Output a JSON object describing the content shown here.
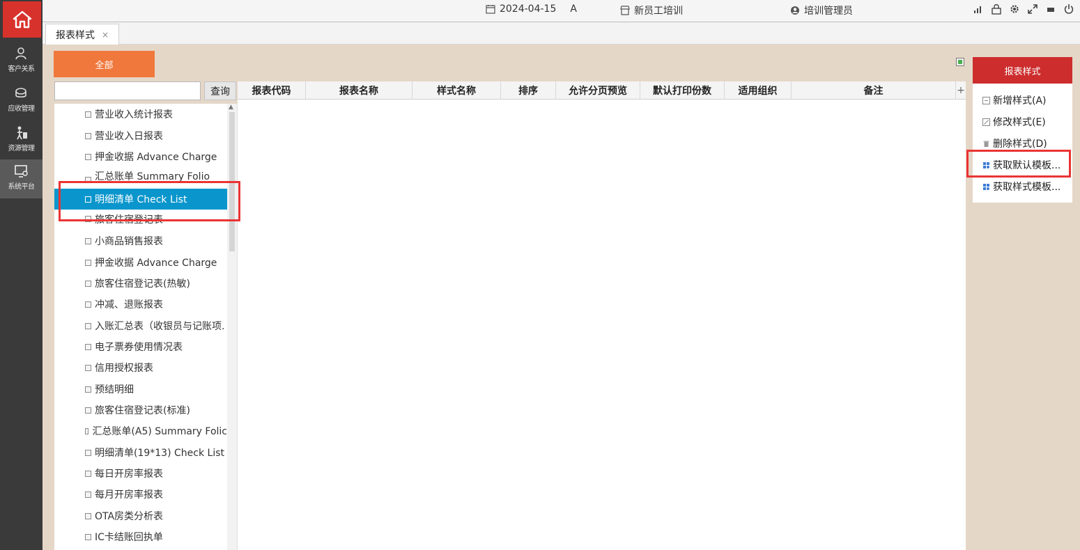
{
  "topbar": {
    "date": "2024-04-15",
    "shift": "A",
    "hotel": "新员工培训",
    "user": "培训管理员"
  },
  "nav": {
    "items": [
      {
        "label": "客户关系",
        "icon": "users-icon"
      },
      {
        "label": "应收管理",
        "icon": "coins-icon"
      },
      {
        "label": "资源管理",
        "icon": "resource-icon"
      },
      {
        "label": "系统平台",
        "icon": "system-settings-icon"
      }
    ]
  },
  "tabs": [
    {
      "label": "报表样式",
      "close": "×"
    }
  ],
  "left": {
    "all_button": "全部",
    "search_placeholder": "",
    "query_button": "查询",
    "tree_items": [
      "营业收入统计报表",
      "营业收入日报表",
      "押金收据 Advance Charge",
      "汇总账单 Summary Folio",
      "明细清单 Check List",
      "旅客住宿登记表",
      "小商品销售报表",
      "押金收据 Advance Charge",
      "旅客住宿登记表(热敏)",
      "冲减、退账报表",
      "入账汇总表（收银员与记账项.",
      "电子票券使用情况表",
      "信用授权报表",
      "预结明细",
      "旅客住宿登记表(标准)",
      "汇总账单(A5) Summary Folic",
      "明细清单(19*13) Check List",
      "每日开房率报表",
      "每月开房率报表",
      "OTA房类分析表",
      "IC卡结账回执单"
    ],
    "selected_index": 4
  },
  "table": {
    "columns": [
      "报表代码",
      "报表名称",
      "样式名称",
      "排序",
      "允许分页预览",
      "默认打印份数",
      "适用组织",
      "备注"
    ],
    "rows": []
  },
  "right_panel": {
    "title": "报表样式",
    "actions": [
      {
        "label": "新增样式(A)",
        "icon": "add-icon"
      },
      {
        "label": "修改样式(E)",
        "icon": "edit-icon"
      },
      {
        "label": "删除样式(D)",
        "icon": "trash-icon"
      },
      {
        "label": "获取默认模板...",
        "icon": "template-icon"
      },
      {
        "label": "获取样式模板...",
        "icon": "template-icon"
      }
    ]
  },
  "colors": {
    "nav_bg": "#3a3a3a",
    "home_red": "#d8322c",
    "all_button": "#f0783c",
    "selected_blue": "#0a96cc",
    "panel_red": "#cd2d2d",
    "content_bg": "#e5d7c8",
    "highlight": "#ea3434"
  }
}
